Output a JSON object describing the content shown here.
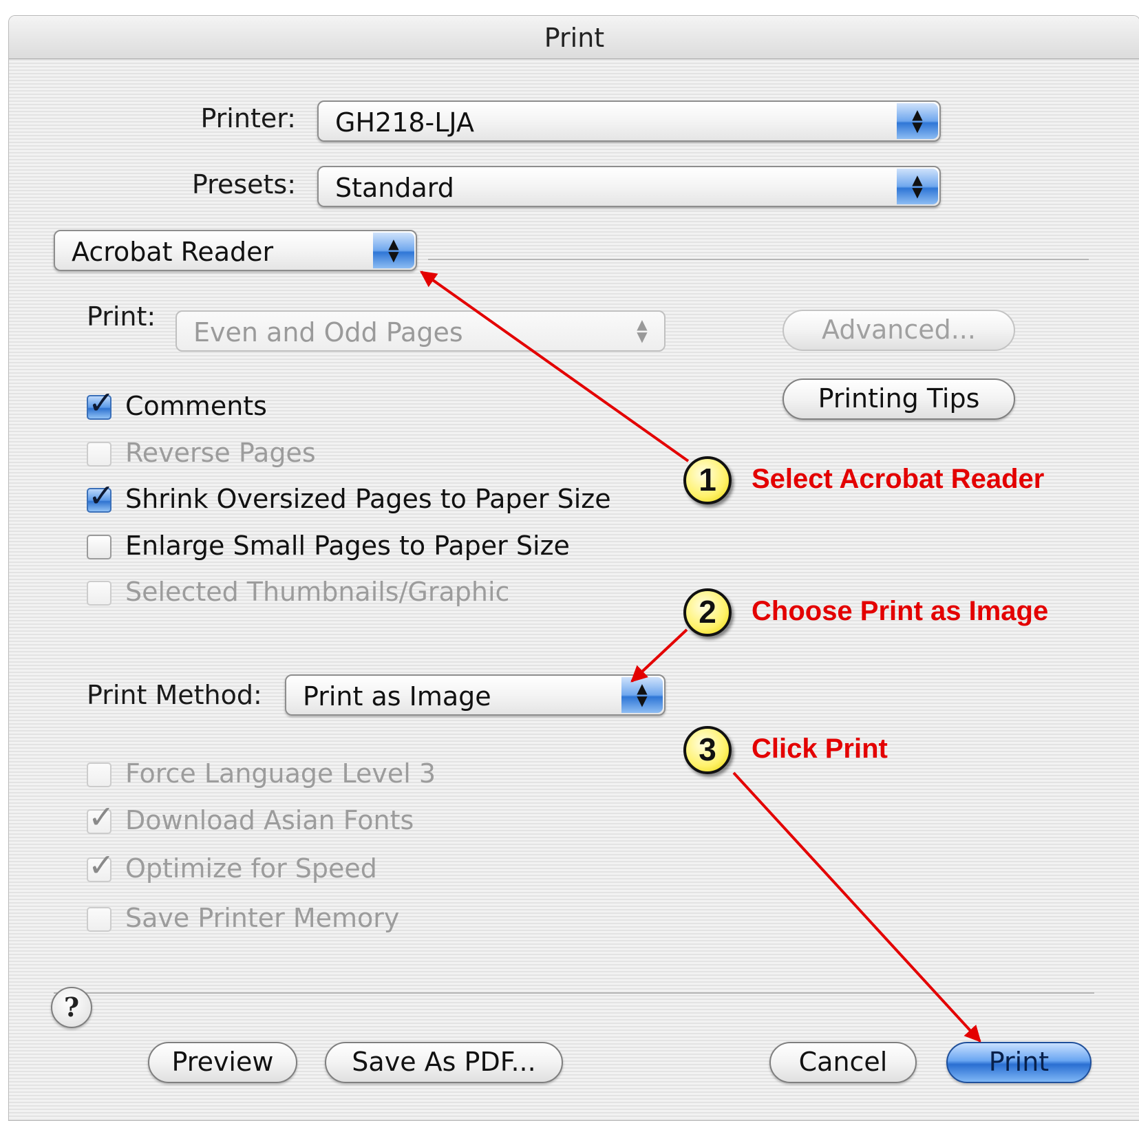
{
  "window": {
    "title": "Print"
  },
  "printer": {
    "label": "Printer:",
    "value": "GH218-LJA"
  },
  "presets": {
    "label": "Presets:",
    "value": "Standard"
  },
  "panel_menu": {
    "value": "Acrobat Reader"
  },
  "print_range": {
    "label": "Print:",
    "value": "Even and Odd Pages"
  },
  "buttons": {
    "advanced": "Advanced...",
    "printing_tips": "Printing Tips",
    "help": "?",
    "preview": "Preview",
    "save_as_pdf": "Save As PDF...",
    "cancel": "Cancel",
    "print": "Print"
  },
  "options": [
    {
      "label": "Comments",
      "checked": true,
      "enabled": true
    },
    {
      "label": "Reverse Pages",
      "checked": false,
      "enabled": false
    },
    {
      "label": "Shrink Oversized Pages to Paper Size",
      "checked": true,
      "enabled": true
    },
    {
      "label": "Enlarge Small Pages to Paper Size",
      "checked": false,
      "enabled": true
    },
    {
      "label": "Selected Thumbnails/Graphic",
      "checked": false,
      "enabled": false
    }
  ],
  "print_method": {
    "label": "Print Method:",
    "value": "Print as Image"
  },
  "method_options": [
    {
      "label": "Force Language Level 3",
      "checked": false,
      "enabled": false
    },
    {
      "label": "Download Asian Fonts",
      "checked": true,
      "enabled": false
    },
    {
      "label": "Optimize for Speed",
      "checked": true,
      "enabled": false
    },
    {
      "label": "Save Printer Memory",
      "checked": false,
      "enabled": false
    }
  ],
  "annotations": [
    {
      "number": "1",
      "prefix": "Select ",
      "target": "Acrobat Reader"
    },
    {
      "number": "2",
      "prefix": "Choose ",
      "target": "Print as Image"
    },
    {
      "number": "3",
      "prefix": "Click ",
      "target": "Print"
    }
  ],
  "colors": {
    "annotation": "#e30000",
    "badge_fill": "#fff26a",
    "accent_blue": "#2f76d6"
  }
}
